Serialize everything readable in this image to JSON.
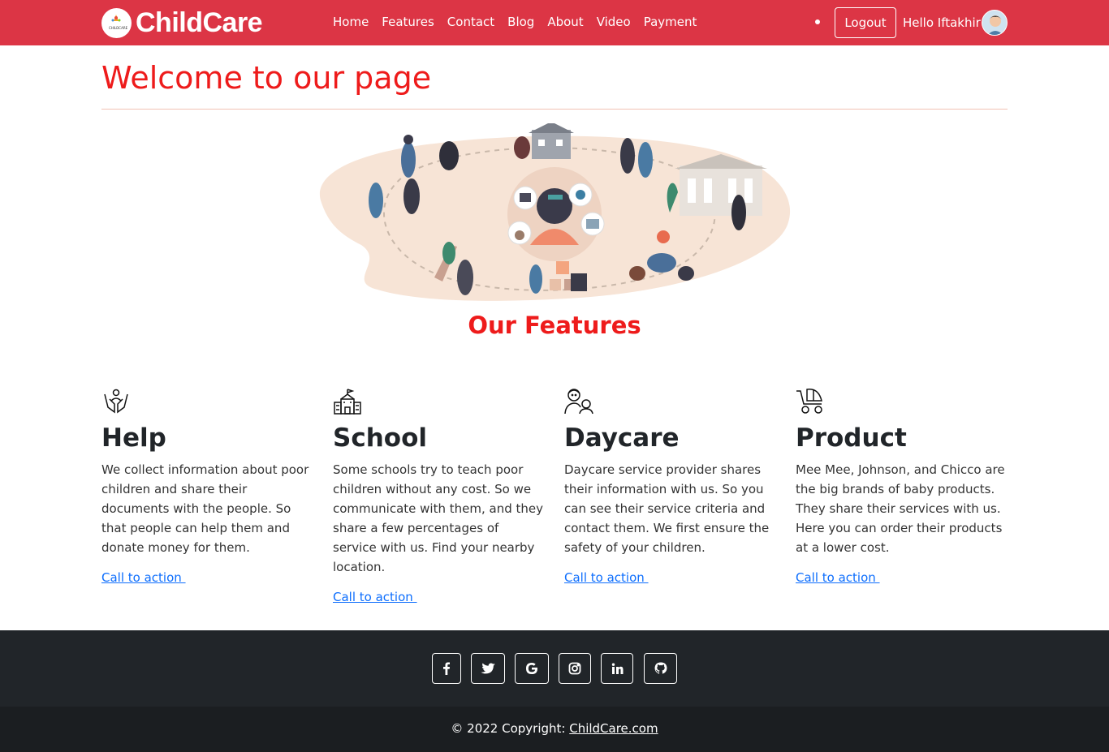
{
  "navbar": {
    "brand": "ChildCare",
    "brand_logo_text": "CHILDCARE",
    "links": [
      "Home",
      "Features",
      "Contact",
      "Blog",
      "About",
      "Video",
      "Payment"
    ],
    "logout_label": "Logout",
    "greeting": "Hello Iftakhir",
    "color": "#dc3545"
  },
  "header": {
    "title": "Welcome to our page",
    "title_color": "#ee1b1b"
  },
  "features": {
    "heading": "Our Features",
    "items": [
      {
        "icon": "helping-hands-icon",
        "title": "Help",
        "text": "We collect information about poor children and share their documents with the people. So that people can help them and donate money for them.",
        "cta": "Call to action "
      },
      {
        "icon": "school-building-icon",
        "title": "School",
        "text": "Some schools try to teach poor children without any cost. So we communicate with them, and they share a few percentages of service with us. Find your nearby location.",
        "cta": "Call to action "
      },
      {
        "icon": "nanny-child-icon",
        "title": "Daycare",
        "text": "Daycare service provider shares their information with us. So you can see their service criteria and contact them. We first ensure the safety of your children.",
        "cta": "Call to action "
      },
      {
        "icon": "baby-stroller-icon",
        "title": "Product",
        "text": "Mee Mee, Johnson, and Chicco are the big brands of baby products. They share their services with us. Here you can order their products at a lower cost.",
        "cta": "Call to action "
      }
    ]
  },
  "footer": {
    "social_icons": [
      "facebook-icon",
      "twitter-icon",
      "google-icon",
      "instagram-icon",
      "linkedin-icon",
      "github-icon"
    ],
    "copyright_prefix": "© 2022 Copyright: ",
    "copyright_link": "ChildCare.com",
    "bg_color": "#212529"
  }
}
